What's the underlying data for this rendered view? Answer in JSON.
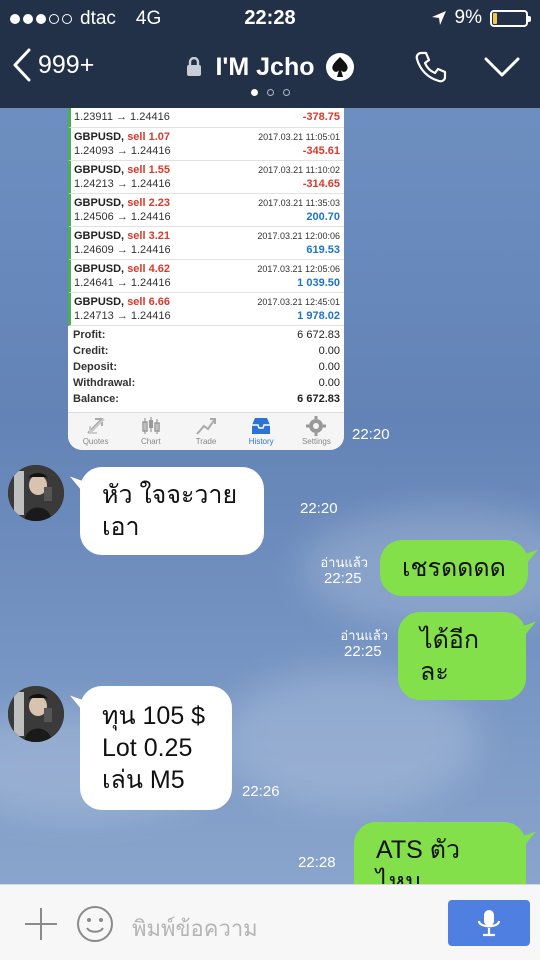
{
  "status": {
    "carrier": "dtac",
    "network": "4G",
    "time": "22:28",
    "battery": "9%",
    "signal_bars": 3,
    "battery_level": 0.09
  },
  "nav": {
    "back_count": "999+",
    "title": "I'M Jcho",
    "page_dots": 3,
    "active_dot": 0
  },
  "trades": [
    {
      "symbol": "",
      "side": "",
      "date": "",
      "price": "1.23911 → 1.24416",
      "pnl": "-378.75",
      "negative": true
    },
    {
      "symbol": "GBPUSD,",
      "side": "sell 1.07",
      "date": "2017.03.21 11:05:01",
      "price": "1.24093 → 1.24416",
      "pnl": "-345.61",
      "negative": true
    },
    {
      "symbol": "GBPUSD,",
      "side": "sell 1.55",
      "date": "2017.03.21 11:10:02",
      "price": "1.24213 → 1.24416",
      "pnl": "-314.65",
      "negative": true
    },
    {
      "symbol": "GBPUSD,",
      "side": "sell 2.23",
      "date": "2017.03.21 11:35:03",
      "price": "1.24506 → 1.24416",
      "pnl": "200.70",
      "negative": false
    },
    {
      "symbol": "GBPUSD,",
      "side": "sell 3.21",
      "date": "2017.03.21 12:00:06",
      "price": "1.24609 → 1.24416",
      "pnl": "619.53",
      "negative": false
    },
    {
      "symbol": "GBPUSD,",
      "side": "sell 4.62",
      "date": "2017.03.21 12:05:06",
      "price": "1.24641 → 1.24416",
      "pnl": "1 039.50",
      "negative": false
    },
    {
      "symbol": "GBPUSD,",
      "side": "sell 6.66",
      "date": "2017.03.21 12:45:01",
      "price": "1.24713 → 1.24416",
      "pnl": "1 978.02",
      "negative": false
    }
  ],
  "summary": [
    {
      "label": "Profit:",
      "value": "6 672.83"
    },
    {
      "label": "Credit:",
      "value": "0.00"
    },
    {
      "label": "Deposit:",
      "value": "0.00"
    },
    {
      "label": "Withdrawal:",
      "value": "0.00"
    },
    {
      "label": "Balance:",
      "value": "6 672.83"
    }
  ],
  "app_tabs": [
    "Quotes",
    "Chart",
    "Trade",
    "History",
    "Settings"
  ],
  "app_active_tab": "History",
  "screenshot_time": "22:20",
  "messages": [
    {
      "from": "them",
      "text": "หัว ใจจะวายเอา",
      "time": "22:20"
    },
    {
      "from": "me",
      "text": "เชรดดดด",
      "read": "อ่านแล้ว",
      "time": "22:25"
    },
    {
      "from": "me",
      "text": "ได้อีกละ",
      "read": "อ่านแล้ว",
      "time": "22:25"
    },
    {
      "from": "them",
      "lines": [
        "ทุน 105 $",
        "Lot 0.25",
        "เล่น M5"
      ],
      "time": "22:26"
    },
    {
      "from": "me",
      "text": "ATS ตัวไหน",
      "time": "22:28"
    }
  ],
  "input": {
    "placeholder": "พิมพ์ข้อความ"
  },
  "colors": {
    "header": "#233148",
    "outgoing": "#84e04a",
    "mic": "#4f80e1",
    "negative": "#d83a2c",
    "positive": "#1f74c8"
  },
  "icons": [
    "back-chevron-icon",
    "lock-icon",
    "spade-icon",
    "phone-icon",
    "chevron-down-icon",
    "location-arrow-icon",
    "battery-icon",
    "plus-icon",
    "emoji-icon",
    "microphone-icon"
  ]
}
